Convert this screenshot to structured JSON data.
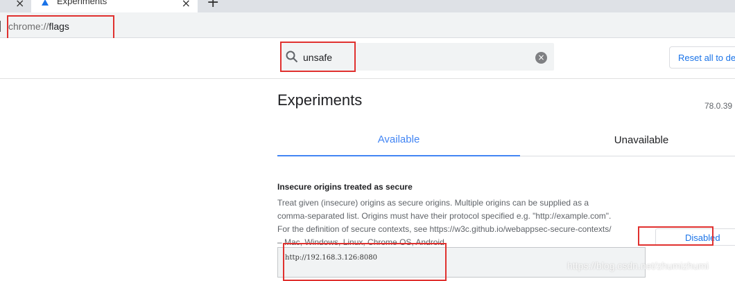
{
  "tab": {
    "title": "Experiments",
    "close": "×"
  },
  "tabstrip": {
    "close_left": "×",
    "new_tab": "+"
  },
  "omnibox": {
    "scheme": "chrome://",
    "host": "flags"
  },
  "search": {
    "value": "unsafe",
    "clear": "×"
  },
  "reset_button": "Reset all to de",
  "page": {
    "title": "Experiments",
    "version": "78.0.39"
  },
  "tabs": [
    {
      "label": "Available",
      "selected": true
    },
    {
      "label": "Unavailable",
      "selected": false
    }
  ],
  "experiment": {
    "title": "Insecure origins treated as secure",
    "desc_lines": [
      "Treat given (insecure) origins as secure origins. Multiple origins can be supplied as a",
      "comma-separated list. Origins must have their protocol specified e.g. \"http://example.com\".",
      "For the definition of secure contexts, see https://w3c.github.io/webappsec-secure-contexts/",
      "– Mac, Windows, Linux, Chrome OS, Android"
    ],
    "textarea_value": "http://192.168.3.126:8080",
    "select_value": "Disabled"
  },
  "watermark": "https://blog.csdn.net/zhumizhumi",
  "colors": {
    "accent": "#4285f4",
    "link": "#1a73e8",
    "annotation": "#e0302e"
  },
  "icons": {
    "favicon": "flask-icon",
    "search": "search-icon",
    "clear": "clear-icon"
  }
}
